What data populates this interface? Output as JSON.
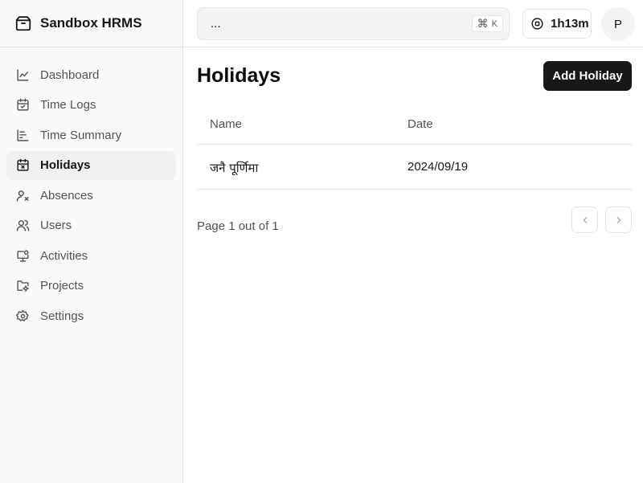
{
  "brand": {
    "name": "Sandbox HRMS",
    "icon": "box-icon"
  },
  "sidebar": {
    "items": [
      {
        "label": "Dashboard",
        "icon": "chart-line-icon",
        "active": false
      },
      {
        "label": "Time Logs",
        "icon": "calendar-check-icon",
        "active": false
      },
      {
        "label": "Time Summary",
        "icon": "bar-chart-icon",
        "active": false
      },
      {
        "label": "Holidays",
        "icon": "calendar-x-icon",
        "active": true
      },
      {
        "label": "Absences",
        "icon": "user-x-icon",
        "active": false
      },
      {
        "label": "Users",
        "icon": "users-icon",
        "active": false
      },
      {
        "label": "Activities",
        "icon": "monitor-icon",
        "active": false
      },
      {
        "label": "Projects",
        "icon": "folder-icon",
        "active": false
      },
      {
        "label": "Settings",
        "icon": "gear-icon",
        "active": false
      }
    ]
  },
  "topbar": {
    "search_value": "...",
    "shortcut_symbol": "⌘",
    "shortcut_key": "K",
    "timer_text": "1h13m",
    "avatar_initial": "P"
  },
  "main": {
    "title": "Holidays",
    "add_button": "Add Holiday",
    "table": {
      "columns": [
        "Name",
        "Date"
      ],
      "rows": [
        {
          "name": "जनै पूर्णिमा",
          "date": "2024/09/19"
        }
      ]
    },
    "pagination": {
      "info": "Page 1 out of 1"
    }
  },
  "colors": {
    "accent": "#18181b",
    "sidebar_bg": "#fafafa",
    "border": "#e4e4e7",
    "muted_text": "#52525b"
  }
}
